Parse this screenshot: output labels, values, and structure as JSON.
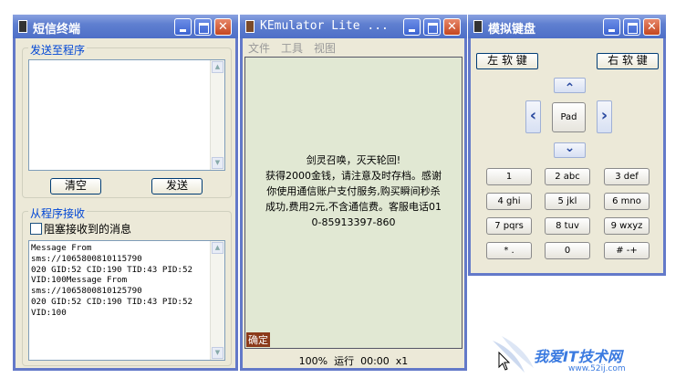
{
  "sms_window": {
    "title": "短信终端",
    "send_group_label": "发送至程序",
    "send_text": "",
    "clear_button": "清空",
    "send_button": "发送",
    "receive_group_label": "从程序接收",
    "block_checkbox_label": "阻塞接收到的消息",
    "block_checked": false,
    "received_messages": "Message From\nsms://1065800810115790\n020 GID:52 CID:190 TID:43 PID:52\nVID:100Message From\nsms://1065800810125790\n020 GID:52 CID:190 TID:43 PID:52\nVID:100"
  },
  "emulator_window": {
    "title": "KEmulator Lite ...",
    "menu": [
      "文件",
      "工具",
      "视图"
    ],
    "screen_lines": [
      "剑灵召唤，灭天轮回!",
      "获得2000金钱，请注意及时存档。感谢",
      "你使用通信账户支付服务,购买瞬间秒杀",
      "成功,费用2元,不含通信费。客服电话01",
      "0-85913397-860"
    ],
    "softkey_label": "确定",
    "status_text": "100%  运行  00:00  x1"
  },
  "keyboard_window": {
    "title": "模拟键盘",
    "left_soft": "左 软 键",
    "right_soft": "右 软 键",
    "pad_label": "Pad",
    "arrows": {
      "up": "⌃",
      "down": "⌄",
      "left": "‹",
      "right": "›"
    },
    "keys": [
      "1",
      "2 abc",
      "3 def",
      "4 ghi",
      "5 jkl",
      "6 mno",
      "7 pqrs",
      "8 tuv",
      "9 wxyz",
      "* .",
      "0",
      "# -+"
    ]
  },
  "watermark": {
    "brand": "我爱IT技术网",
    "url": "www.52ij.com"
  },
  "colors": {
    "titlebar": "#4e6fc7",
    "window_bg": "#ece9d8",
    "screen_bg": "#e1e8d3",
    "group_label": "#0046d5"
  }
}
